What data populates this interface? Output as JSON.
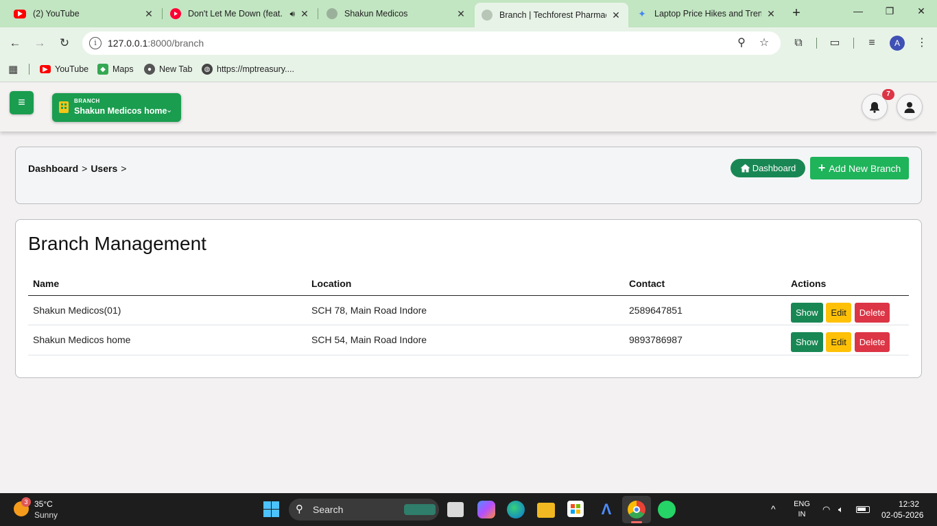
{
  "browser": {
    "tabs": [
      {
        "title": "(2) YouTube",
        "active": false
      },
      {
        "title": "Don't Let Me Down (feat.",
        "active": false
      },
      {
        "title": "Shakun Medicos",
        "active": false
      },
      {
        "title": "Branch | Techforest Pharmacy",
        "active": true
      },
      {
        "title": "Laptop Price Hikes and Trends",
        "active": false
      }
    ],
    "url_host": "127.0.0.1",
    "url_rest": ":8000/branch",
    "profile_initial": "A",
    "bookmarks": [
      "YouTube",
      "Maps",
      "New Tab",
      "https://mptreasury...."
    ]
  },
  "header": {
    "branch_caption": "BRANCH",
    "branch_name": "Shakun Medicos home",
    "notification_count": "7"
  },
  "breadcrumb": {
    "items": [
      "Dashboard",
      "Users"
    ],
    "separator": ">"
  },
  "actions": {
    "dashboard_label": "Dashboard",
    "add_label": "Add New Branch"
  },
  "page": {
    "title": "Branch Management"
  },
  "table": {
    "columns": [
      "Name",
      "Location",
      "Contact",
      "Actions"
    ],
    "rows": [
      {
        "name": "Shakun Medicos(01)",
        "location": "SCH 78, Main Road Indore",
        "contact": "2589647851"
      },
      {
        "name": "Shakun Medicos home",
        "location": "SCH 54, Main Road Indore",
        "contact": "9893786987"
      }
    ],
    "row_actions": {
      "show": "Show",
      "edit": "Edit",
      "delete": "Delete"
    }
  },
  "taskbar": {
    "weather_temp": "35°C",
    "weather_desc": "Sunny",
    "weather_badge": "3",
    "search_label": "Search",
    "lang_top": "ENG",
    "lang_bottom": "IN",
    "time": "12:32",
    "date": "02-05-2026"
  },
  "colors": {
    "brand_green": "#1a9d4f",
    "show_green": "#198754",
    "edit_yellow": "#ffc107",
    "delete_red": "#dc3545",
    "chrome_green": "#c2e5c2"
  }
}
